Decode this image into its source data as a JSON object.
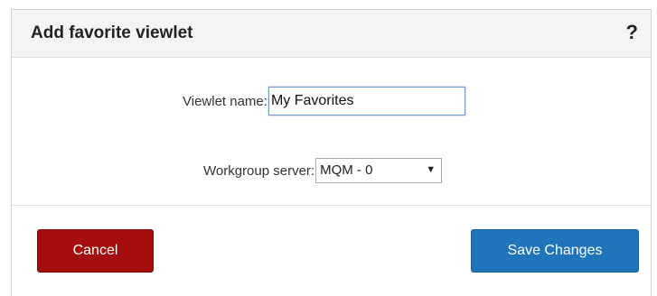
{
  "dialog": {
    "title": "Add favorite viewlet",
    "help_glyph": "?"
  },
  "form": {
    "viewlet_name": {
      "label": "Viewlet name:",
      "value": "My Favorites"
    },
    "workgroup_server": {
      "label": "Workgroup server:",
      "selected": "MQM - 0",
      "arrow_glyph": "▼"
    }
  },
  "footer": {
    "cancel_label": "Cancel",
    "save_label": "Save Changes"
  },
  "colors": {
    "cancel_bg": "#a50e0e",
    "save_bg": "#1f74ba",
    "header_bg": "#f4f4f4"
  }
}
